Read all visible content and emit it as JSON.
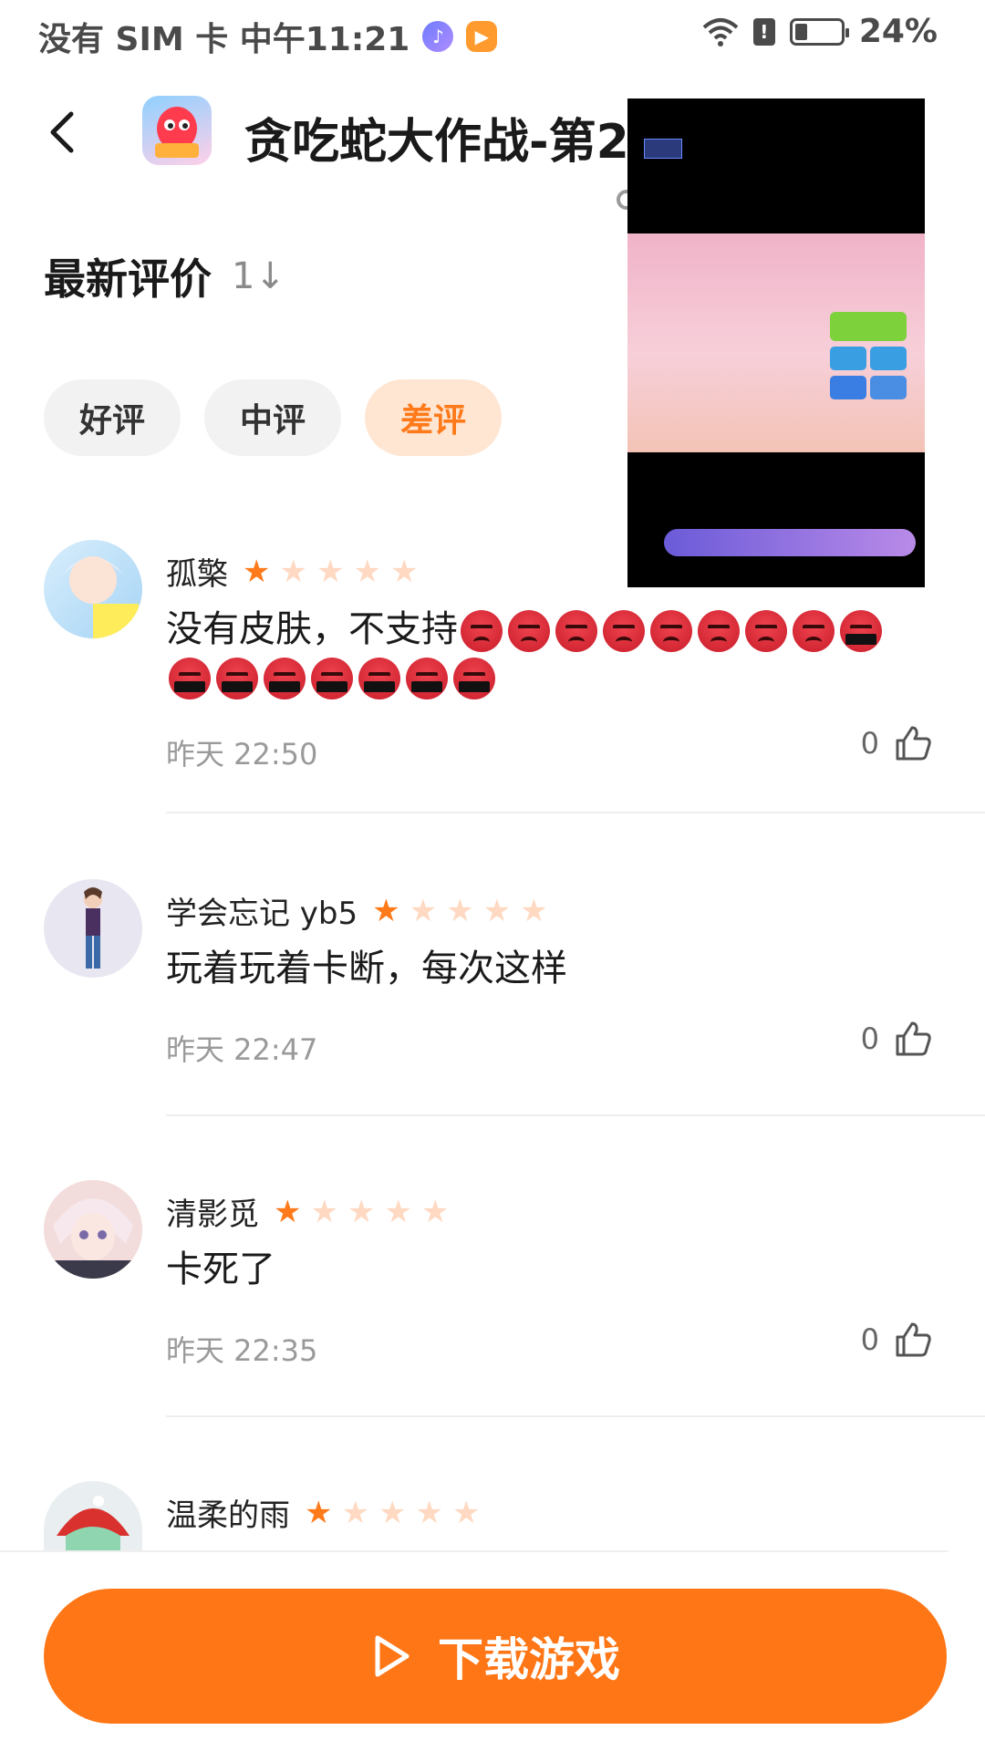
{
  "status_bar": {
    "carrier_time": "没有 SIM 卡 中午11:21",
    "battery": "24%",
    "battery_level": 0.24
  },
  "header": {
    "title": "贪吃蛇大作战-第2",
    "logo_icon": "game-logo-icon"
  },
  "section": {
    "title": "最新评价",
    "sort_icon": "1↓"
  },
  "filters": [
    {
      "label": "好评",
      "active": false
    },
    {
      "label": "中评",
      "active": false
    },
    {
      "label": "差评",
      "active": true
    }
  ],
  "reviews": [
    {
      "name": "孤檠",
      "rating": 1,
      "text": "没有皮肤，不支持",
      "angry_emoji_count": 16,
      "time": "昨天 22:50",
      "likes": "0"
    },
    {
      "name": "学会忘记 yb5",
      "rating": 1,
      "text": "玩着玩着卡断，每次这样",
      "time": "昨天 22:47",
      "likes": "0"
    },
    {
      "name": "清影觅",
      "rating": 1,
      "text": "卡死了",
      "time": "昨天 22:35",
      "likes": "0"
    },
    {
      "name": "温柔的雨",
      "rating": 1
    }
  ],
  "bottom": {
    "download_label": "下载游戏"
  },
  "colors": {
    "accent": "#ff7616",
    "chip_active_bg": "#ffe6d3",
    "star_on": "#ff7a1a",
    "star_off": "#ffd9c2"
  }
}
